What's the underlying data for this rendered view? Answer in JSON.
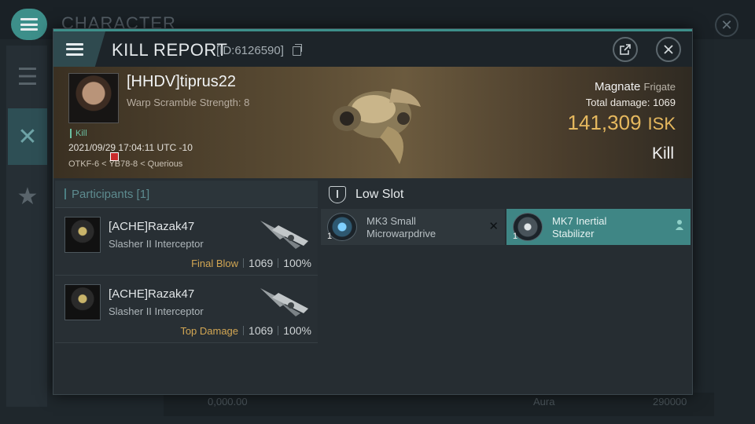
{
  "background": {
    "title": "CHARACTER",
    "bottom_value": "0,000.00",
    "bottom_right_a": "Aura",
    "bottom_right_b": "290000"
  },
  "panel": {
    "title": "KILL REPORT",
    "id_text": "[ID:6126590]"
  },
  "victim": {
    "name": "[HHDV]tiprus22",
    "warp_scramble": "Warp Scramble Strength: 8",
    "status_tag": "Kill",
    "timestamp": "2021/09/29 17:04:11 UTC -10",
    "location": "OTKF-6 < YB78-8 < Querious",
    "ship_name": "Magnate",
    "ship_class": "Frigate",
    "total_damage_label": "Total damage:",
    "total_damage_value": "1069",
    "isk_value": "141,309",
    "isk_unit": "ISK",
    "result": "Kill"
  },
  "participants": {
    "header": "Participants [1]",
    "rows": [
      {
        "name": "[ACHE]Razak47",
        "ship": "Slasher II Interceptor",
        "tag": "Final Blow",
        "damage": "1069",
        "percent": "100%"
      },
      {
        "name": "[ACHE]Razak47",
        "ship": "Slasher II Interceptor",
        "tag": "Top Damage",
        "damage": "1069",
        "percent": "100%"
      }
    ]
  },
  "fitting": {
    "slot_label": "Low Slot",
    "modules": [
      {
        "qty": "1",
        "line1": "MK3 Small",
        "line2": "Microwarpdrive",
        "icon": "microwarpdrive-icon"
      },
      {
        "qty": "1",
        "line1": "MK7 Inertial",
        "line2": "Stabilizer",
        "icon": "inertial-stabilizer-icon"
      }
    ]
  },
  "colors": {
    "accent": "#3d8f8a",
    "isk": "#e5b85e",
    "tag": "#d2a653",
    "selected_module": "#3f8685"
  }
}
